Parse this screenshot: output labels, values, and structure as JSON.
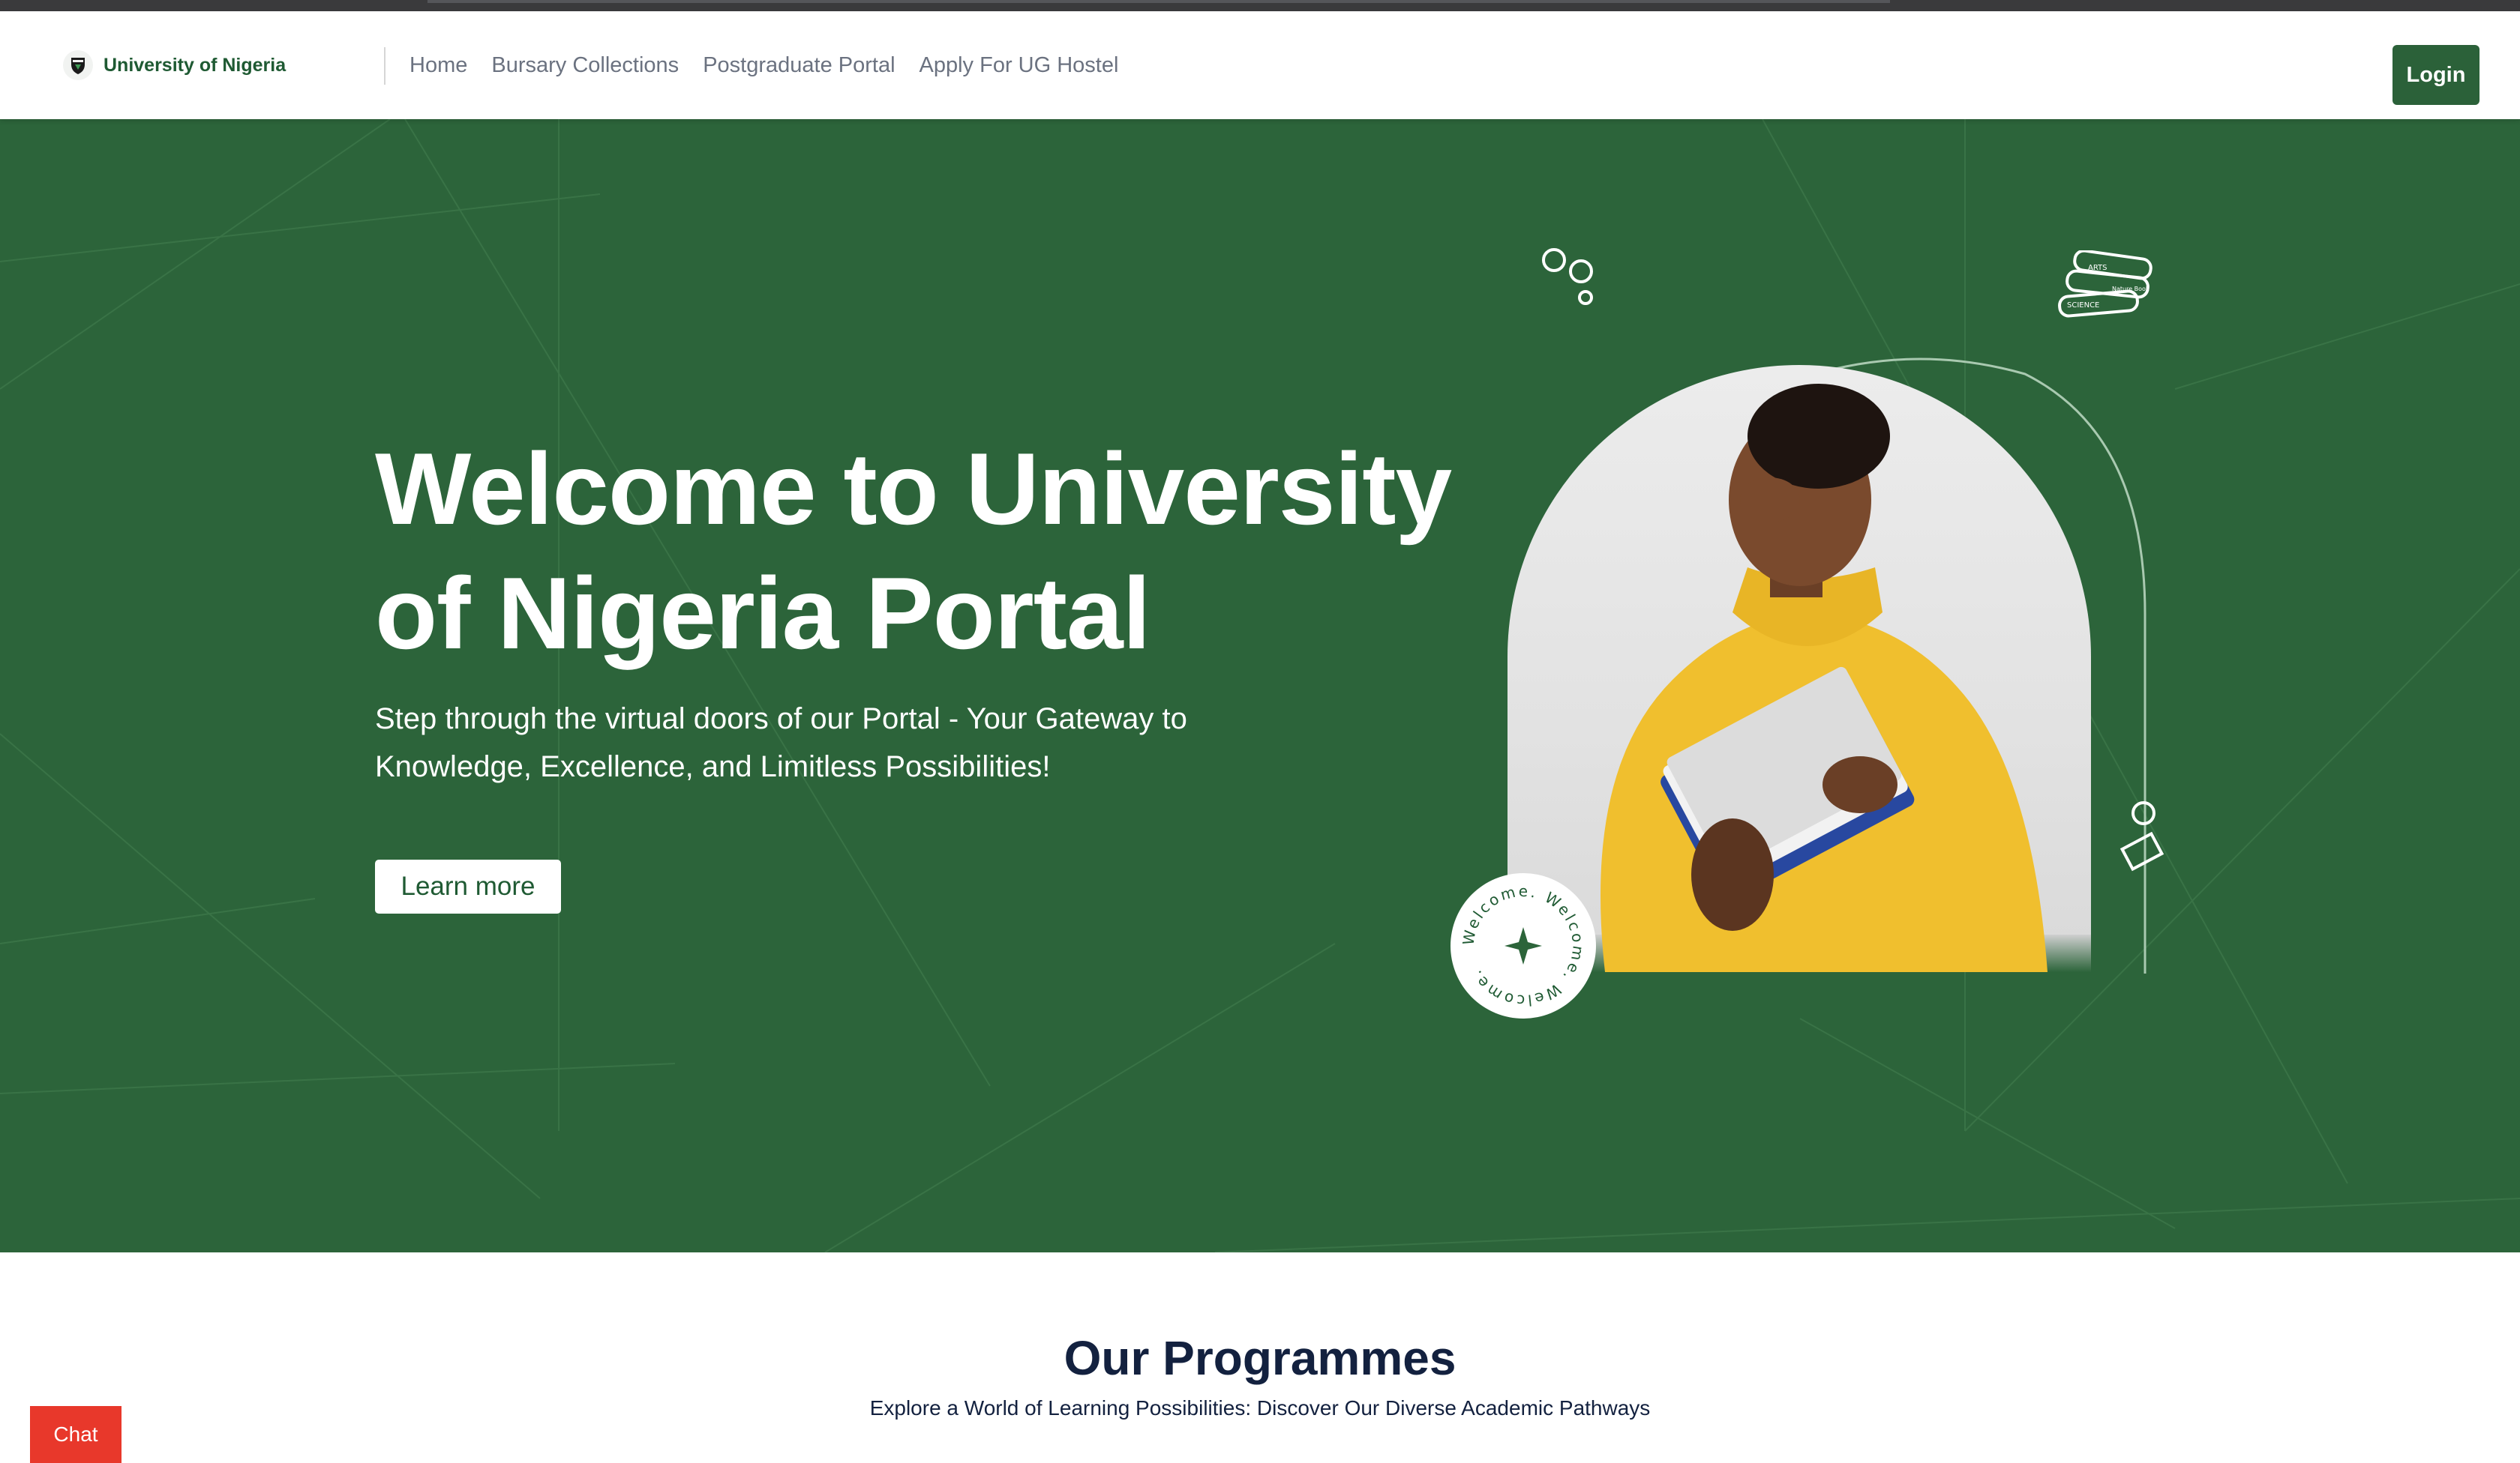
{
  "header": {
    "brand_name": "University of Nigeria",
    "brand_logo_icon": "crest-icon",
    "nav_links": [
      {
        "label": "Home"
      },
      {
        "label": "Bursary Collections"
      },
      {
        "label": "Postgraduate Portal"
      },
      {
        "label": "Apply For UG Hostel"
      }
    ],
    "login_label": "Login"
  },
  "hero": {
    "title": "Welcome to University of Nigeria Portal",
    "subtitle": "Step through the virtual doors of our Portal - Your Gateway to Knowledge, Excellence, and Limitless Possibilities!",
    "cta_label": "Learn more",
    "badge_text": "Welcome. Welcome. Welcome.",
    "book_labels": [
      "ARTS",
      "Nature Book",
      "SCIENCE"
    ]
  },
  "programmes": {
    "title": "Our Programmes",
    "subtitle": "Explore a World of Learning Possibilities: Discover Our Diverse Academic Pathways"
  },
  "chat": {
    "label": "Chat"
  },
  "colors": {
    "brand_green": "#2c643a",
    "button_green": "#2b6139",
    "heading_navy": "#13213f",
    "chat_red": "#e8382b",
    "sweater_yellow": "#f0bf2e"
  }
}
